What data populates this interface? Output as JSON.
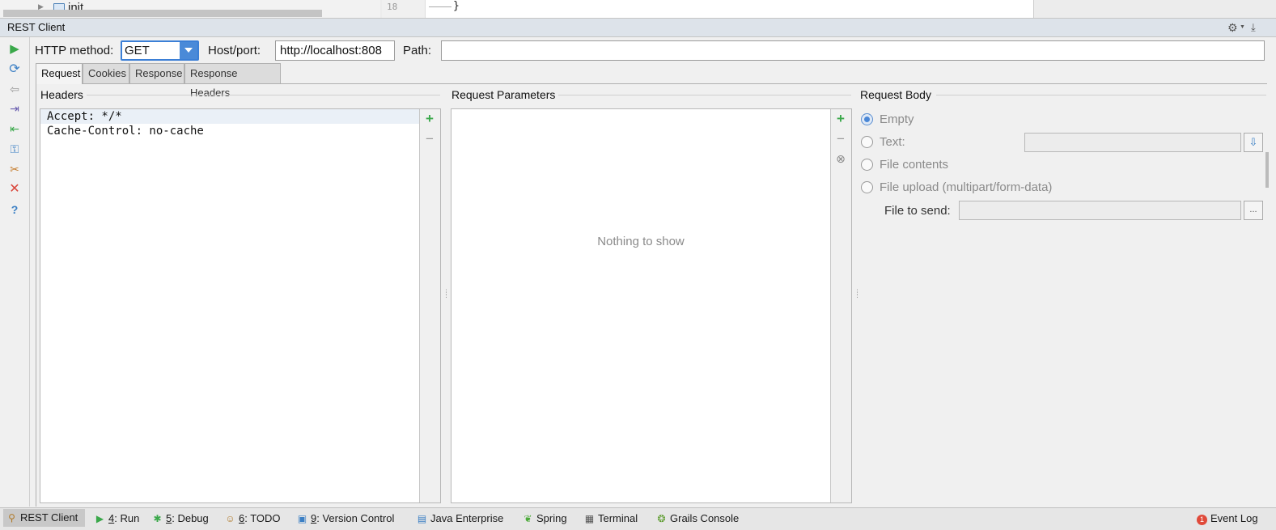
{
  "top_strip": {
    "tree_label": "init",
    "line_number": "18",
    "code_fragment": "}"
  },
  "tool_window": {
    "title": "REST Client"
  },
  "toolbar": {
    "icons": [
      "run-icon",
      "refresh-icon",
      "back-icon",
      "export-icon",
      "import-icon",
      "generate-icon",
      "config-icon",
      "clear-icon",
      "help-icon"
    ]
  },
  "form": {
    "method_label": "HTTP method:",
    "method_value": "GET",
    "host_label": "Host/port:",
    "host_value": "http://localhost:808",
    "path_label": "Path:",
    "path_value": ""
  },
  "tabs": [
    {
      "label": "Request",
      "active": true
    },
    {
      "label": "Cookies",
      "active": false
    },
    {
      "label": "Response",
      "active": false
    },
    {
      "label": "Response Headers",
      "active": false
    }
  ],
  "headers": {
    "title": "Headers",
    "rows": [
      "Accept: */*",
      "Cache-Control: no-cache"
    ]
  },
  "params": {
    "title": "Request Parameters",
    "empty_text": "Nothing to show"
  },
  "body": {
    "title": "Request Body",
    "options": [
      {
        "label": "Empty",
        "checked": true
      },
      {
        "label": "Text:",
        "checked": false
      },
      {
        "label": "File contents",
        "checked": false
      },
      {
        "label": "File upload (multipart/form-data)",
        "checked": false
      }
    ],
    "text_value": "",
    "file_to_send_label": "File to send:",
    "file_to_send_value": "",
    "browse_label": "..."
  },
  "status_bar": {
    "items": [
      {
        "label": "REST Client",
        "active": true
      },
      {
        "hotkey": "4",
        "label": ": Run"
      },
      {
        "hotkey": "5",
        "label": ": Debug"
      },
      {
        "hotkey": "6",
        "label": ": TODO"
      },
      {
        "hotkey": "9",
        "label": ": Version Control"
      },
      {
        "label": "Java Enterprise"
      },
      {
        "label": "Spring"
      },
      {
        "label": "Terminal"
      },
      {
        "label": "Grails Console"
      }
    ],
    "event_log": "Event Log",
    "event_log_count": "1"
  },
  "colors": {
    "accent": "#3b7fd6",
    "run_green": "#3aa84a",
    "error_red": "#d9453a"
  }
}
